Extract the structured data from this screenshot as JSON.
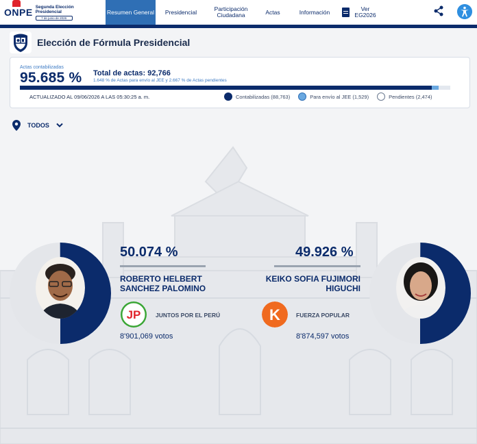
{
  "header": {
    "logo_text": "ONPE",
    "logo_title": "Segunda Elección Presidencial",
    "logo_date": "7 de junio de 2026",
    "nav": [
      {
        "label": "Resumen General",
        "active": true
      },
      {
        "label": "Presidencial",
        "active": false
      },
      {
        "label": "Participación Ciudadana",
        "active": false
      },
      {
        "label": "Actas",
        "active": false
      },
      {
        "label": "Información",
        "active": false
      }
    ],
    "ver_label": "Ver EG2026"
  },
  "page": {
    "title": "Elección de Fórmula Presidencial"
  },
  "actas": {
    "label": "Actas contabilizadas",
    "percent": "95.685 %",
    "total": "Total de actas: 92,766",
    "sub": "1.648 % de Actas para envío al JEE y 2.667 % de Actas pendientes",
    "updated": "ACTUALIZADO AL 09/06/2026 A LAS 05:30:25 a. m.",
    "progress": {
      "contabilizadas": 95.685,
      "jee": 1.648,
      "pendientes": 2.667
    },
    "legend": [
      {
        "label": "Contabilizadas (88,763)",
        "color": "#0b2b6b"
      },
      {
        "label": "Para envío al JEE (1,529)",
        "color": "#6aa8e0"
      },
      {
        "label": "Pendientes (2,474)",
        "color": "#ffffff"
      }
    ]
  },
  "filter": {
    "label": "TODOS"
  },
  "candidates": [
    {
      "percent": "50.074 %",
      "share": 50.074,
      "name": "ROBERTO HELBERT SANCHEZ PALOMINO",
      "party": "JUNTOS POR EL PERÚ",
      "votes": "8'901,069 votos",
      "color": "#0b2b6b"
    },
    {
      "percent": "49.926 %",
      "share": 49.926,
      "name": "KEIKO SOFIA FUJIMORI HIGUCHI",
      "party": "FUERZA POPULAR",
      "votes": "8'874,597 votos",
      "color": "#0b2b6b"
    }
  ],
  "colors": {
    "navy": "#0b2b6b",
    "accent": "#2f6fb5",
    "jee": "#6aa8e0",
    "jp_red": "#e0242b",
    "jp_green": "#3aa635",
    "fp_orange": "#f06a1f"
  }
}
